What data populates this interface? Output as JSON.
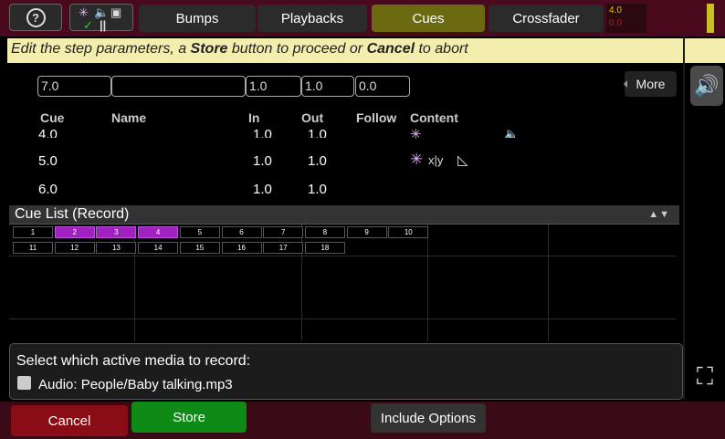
{
  "topbar": {
    "tabs": [
      "Bumps",
      "Playbacks",
      "Cues",
      "Crossfader"
    ],
    "level_values": [
      "4.0",
      "0.0"
    ],
    "colors": {
      "active_tab": "#6b6a10",
      "bar": "#4a0a1e"
    }
  },
  "prompt": {
    "pre": "Edit the step parameters, a ",
    "store": "Store",
    "mid": " button to proceed or ",
    "cancel": "Cancel",
    "post": " to abort"
  },
  "fields": {
    "cue": "7.0",
    "name": "",
    "in": "1.0",
    "out": "1.0",
    "follow": "0.0"
  },
  "more_label": "More",
  "cue_table": {
    "headers": [
      "Cue",
      "Name",
      "In",
      "Out",
      "Follow",
      "Content"
    ],
    "rows": [
      {
        "cue": "4.0",
        "in": "1.0",
        "out": "1.0"
      },
      {
        "cue": "5.0",
        "in": "1.0",
        "out": "1.0"
      },
      {
        "cue": "6.0",
        "in": "1.0",
        "out": "1.0"
      }
    ]
  },
  "cue_list": {
    "title": "Cue List (Record)",
    "cues": [
      "1",
      "2",
      "3",
      "4",
      "5",
      "6",
      "7",
      "8",
      "9",
      "10",
      "11",
      "12",
      "13",
      "14",
      "15",
      "16",
      "17",
      "18"
    ],
    "selected": [
      "2",
      "3",
      "4"
    ],
    "colors": {
      "selected": "#a020c0"
    }
  },
  "media": {
    "title": "Select which active media to record:",
    "item": "Audio: People/Baby talking.mp3"
  },
  "bottom": {
    "cancel": "Cancel",
    "store": "Store",
    "include": "Include Options"
  }
}
